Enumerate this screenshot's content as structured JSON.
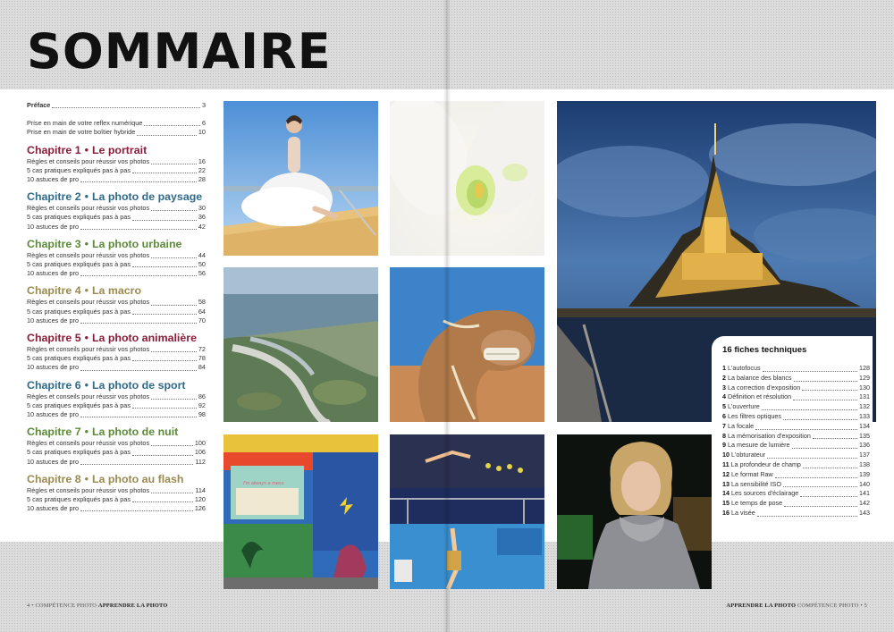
{
  "colors": {
    "chapter_1": "#8b1d3a",
    "chapter_2": "#2f6a8a",
    "chapter_3": "#5d8a3a",
    "chapter_4": "#9a8a50",
    "chapter_5": "#8b1d3a",
    "chapter_6": "#2f6a8a",
    "chapter_7": "#5d8a3a",
    "chapter_8": "#9a8a50"
  },
  "page": {
    "title": "SOMMAIRE"
  },
  "toc": {
    "intro": [
      {
        "label": "Préface",
        "page": "3",
        "bold": true
      },
      {
        "label": "Prise en main de votre reflex numérique",
        "page": "6",
        "bold": false
      },
      {
        "label": "Prise en main de votre boîtier hybride",
        "page": "10",
        "bold": false
      }
    ],
    "chapters": [
      {
        "prefix": "Chapitre 1",
        "bullet": "•",
        "name": "Le portrait",
        "color_key": "chapter_1",
        "entries": [
          {
            "label": "Règles et conseils pour réussir vos photos",
            "page": "16"
          },
          {
            "label": "5 cas pratiques expliqués pas à pas",
            "page": "22"
          },
          {
            "label": "10 astuces de pro",
            "page": "28"
          }
        ]
      },
      {
        "prefix": "Chapitre 2",
        "bullet": "•",
        "name": "La photo de paysage",
        "color_key": "chapter_2",
        "entries": [
          {
            "label": "Règles et conseils pour réussir vos photos",
            "page": "30"
          },
          {
            "label": "5 cas pratiques expliqués pas à pas",
            "page": "36"
          },
          {
            "label": "10 astuces de pro",
            "page": "42"
          }
        ]
      },
      {
        "prefix": "Chapitre 3",
        "bullet": "•",
        "name": "La photo urbaine",
        "color_key": "chapter_3",
        "entries": [
          {
            "label": "Règles et conseils pour réussir vos photos",
            "page": "44"
          },
          {
            "label": "5 cas pratiques expliqués pas à pas",
            "page": "50"
          },
          {
            "label": "10 astuces de pro",
            "page": "56"
          }
        ]
      },
      {
        "prefix": "Chapitre 4",
        "bullet": "•",
        "name": "La macro",
        "color_key": "chapter_4",
        "entries": [
          {
            "label": "Règles et conseils pour réussir vos photos",
            "page": "58"
          },
          {
            "label": "5 cas pratiques expliqués pas à pas",
            "page": "64"
          },
          {
            "label": "10 astuces de pro",
            "page": "70"
          }
        ]
      },
      {
        "prefix": "Chapitre 5",
        "bullet": "•",
        "name": "La photo animalière",
        "color_key": "chapter_5",
        "entries": [
          {
            "label": "Règles et conseils pour réussir vos photos",
            "page": "72"
          },
          {
            "label": "5 cas pratiques expliqués pas à pas",
            "page": "78"
          },
          {
            "label": "10 astuces de pro",
            "page": "84"
          }
        ]
      },
      {
        "prefix": "Chapitre 6",
        "bullet": "•",
        "name": "La photo de sport",
        "color_key": "chapter_6",
        "entries": [
          {
            "label": "Règles et conseils pour réussir vos photos",
            "page": "86"
          },
          {
            "label": "5 cas pratiques expliqués pas à pas",
            "page": "92"
          },
          {
            "label": "10 astuces de pro",
            "page": "98"
          }
        ]
      },
      {
        "prefix": "Chapitre 7",
        "bullet": "•",
        "name": "La photo de nuit",
        "color_key": "chapter_7",
        "entries": [
          {
            "label": "Règles et conseils pour réussir vos photos",
            "page": "100"
          },
          {
            "label": "5 cas pratiques expliqués pas à pas",
            "page": "106"
          },
          {
            "label": "10 astuces de pro",
            "page": "112"
          }
        ]
      },
      {
        "prefix": "Chapitre 8",
        "bullet": "•",
        "name": "La photo au flash",
        "color_key": "chapter_8",
        "entries": [
          {
            "label": "Règles et conseils pour réussir vos photos",
            "page": "114"
          },
          {
            "label": "5 cas pratiques expliqués pas à pas",
            "page": "120"
          },
          {
            "label": "10 astuces de pro",
            "page": "126"
          }
        ]
      }
    ]
  },
  "fiches": {
    "title": "16 fiches techniques",
    "items": [
      {
        "num": "1",
        "label": "L'autofocus",
        "page": "128"
      },
      {
        "num": "2",
        "label": "La balance des blancs",
        "page": "129"
      },
      {
        "num": "3",
        "label": "La correction d'exposition",
        "page": "130"
      },
      {
        "num": "4",
        "label": "Définition et résolution",
        "page": "131"
      },
      {
        "num": "5",
        "label": "L'ouverture",
        "page": "132"
      },
      {
        "num": "6",
        "label": "Les filtres optiques",
        "page": "133"
      },
      {
        "num": "7",
        "label": "La focale",
        "page": "134"
      },
      {
        "num": "8",
        "label": "La mémorisation d'exposition",
        "page": "135"
      },
      {
        "num": "9",
        "label": "La mesure de lumière",
        "page": "136"
      },
      {
        "num": "10",
        "label": "L'obturateur",
        "page": "137"
      },
      {
        "num": "11",
        "label": "La profondeur de champ",
        "page": "138"
      },
      {
        "num": "12",
        "label": "Le format Raw",
        "page": "139"
      },
      {
        "num": "13",
        "label": "La sensibilité ISO",
        "page": "140"
      },
      {
        "num": "14",
        "label": "Les sources d'éclairage",
        "page": "141"
      },
      {
        "num": "15",
        "label": "Le temps de pose",
        "page": "142"
      },
      {
        "num": "16",
        "label": "La visée",
        "page": "143"
      }
    ]
  },
  "signs": {
    "shop_sign": "I'm always a mess"
  },
  "footer": {
    "left_page": "4",
    "left_magazine": "COMPÉTENCE PHOTO",
    "left_title": "APPRENDRE LA PHOTO",
    "right_title": "APPRENDRE LA PHOTO",
    "right_magazine": "COMPÉTENCE PHOTO",
    "right_page": "5"
  }
}
